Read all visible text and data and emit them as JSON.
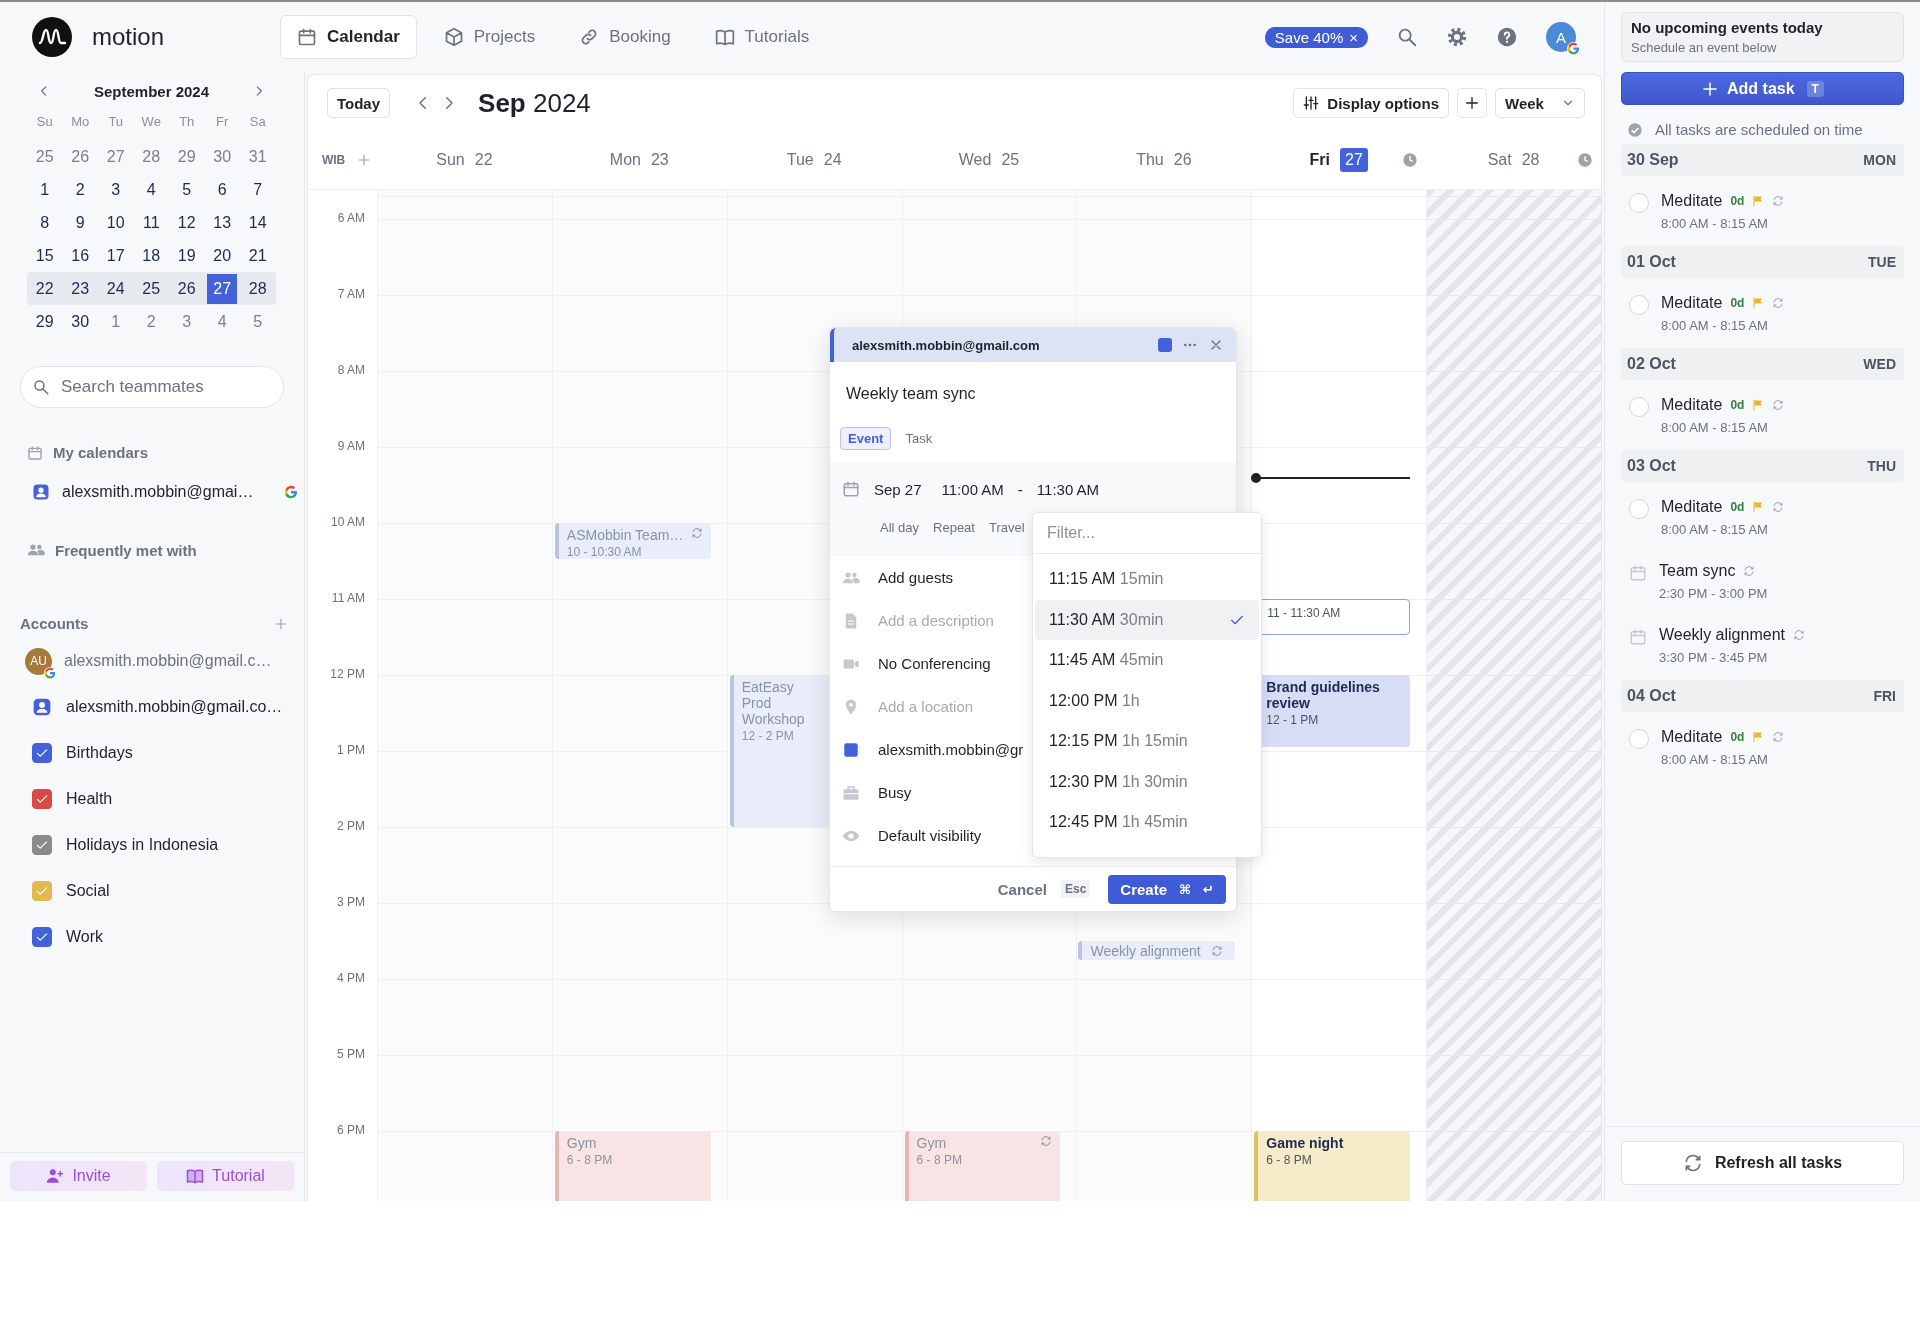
{
  "app": {
    "name": "motion"
  },
  "nav": {
    "tabs": [
      {
        "label": "Calendar",
        "selected": true
      },
      {
        "label": "Projects",
        "selected": false
      },
      {
        "label": "Booking",
        "selected": false
      },
      {
        "label": "Tutorials",
        "selected": false
      }
    ]
  },
  "promo": {
    "label": "Save 40%",
    "close": "×"
  },
  "avatar": {
    "initial": "A"
  },
  "mini_calendar": {
    "title": "September 2024",
    "weekdays": [
      "Su",
      "Mo",
      "Tu",
      "We",
      "Th",
      "Fr",
      "Sa"
    ],
    "weeks": [
      {
        "highlighted": false,
        "days": [
          {
            "day": "25",
            "muted": true,
            "selected": false
          },
          {
            "day": "26",
            "muted": true,
            "selected": false
          },
          {
            "day": "27",
            "muted": true,
            "selected": false
          },
          {
            "day": "28",
            "muted": true,
            "selected": false
          },
          {
            "day": "29",
            "muted": true,
            "selected": false
          },
          {
            "day": "30",
            "muted": true,
            "selected": false
          },
          {
            "day": "31",
            "muted": true,
            "selected": false
          }
        ]
      },
      {
        "highlighted": false,
        "days": [
          {
            "day": "1",
            "muted": false,
            "selected": false
          },
          {
            "day": "2",
            "muted": false,
            "selected": false
          },
          {
            "day": "3",
            "muted": false,
            "selected": false
          },
          {
            "day": "4",
            "muted": false,
            "selected": false
          },
          {
            "day": "5",
            "muted": false,
            "selected": false
          },
          {
            "day": "6",
            "muted": false,
            "selected": false
          },
          {
            "day": "7",
            "muted": false,
            "selected": false
          }
        ]
      },
      {
        "highlighted": false,
        "days": [
          {
            "day": "8",
            "muted": false,
            "selected": false
          },
          {
            "day": "9",
            "muted": false,
            "selected": false
          },
          {
            "day": "10",
            "muted": false,
            "selected": false
          },
          {
            "day": "11",
            "muted": false,
            "selected": false
          },
          {
            "day": "12",
            "muted": false,
            "selected": false
          },
          {
            "day": "13",
            "muted": false,
            "selected": false
          },
          {
            "day": "14",
            "muted": false,
            "selected": false
          }
        ]
      },
      {
        "highlighted": false,
        "days": [
          {
            "day": "15",
            "muted": false,
            "selected": false
          },
          {
            "day": "16",
            "muted": false,
            "selected": false
          },
          {
            "day": "17",
            "muted": false,
            "selected": false
          },
          {
            "day": "18",
            "muted": false,
            "selected": false
          },
          {
            "day": "19",
            "muted": false,
            "selected": false
          },
          {
            "day": "20",
            "muted": false,
            "selected": false
          },
          {
            "day": "21",
            "muted": false,
            "selected": false
          }
        ]
      },
      {
        "highlighted": true,
        "days": [
          {
            "day": "22",
            "muted": false,
            "selected": false
          },
          {
            "day": "23",
            "muted": false,
            "selected": false
          },
          {
            "day": "24",
            "muted": false,
            "selected": false
          },
          {
            "day": "25",
            "muted": false,
            "selected": false
          },
          {
            "day": "26",
            "muted": false,
            "selected": false
          },
          {
            "day": "27",
            "muted": false,
            "selected": true
          },
          {
            "day": "28",
            "muted": false,
            "selected": false
          }
        ]
      },
      {
        "highlighted": false,
        "days": [
          {
            "day": "29",
            "muted": false,
            "selected": false
          },
          {
            "day": "30",
            "muted": false,
            "selected": false
          },
          {
            "day": "1",
            "muted": true,
            "selected": false
          },
          {
            "day": "2",
            "muted": true,
            "selected": false
          },
          {
            "day": "3",
            "muted": true,
            "selected": false
          },
          {
            "day": "4",
            "muted": true,
            "selected": false
          },
          {
            "day": "5",
            "muted": true,
            "selected": false
          }
        ]
      }
    ]
  },
  "team_search": {
    "placeholder": "Search teammates"
  },
  "my_calendars": {
    "title": "My calendars",
    "items": [
      {
        "label": "alexsmith.mobbin@gmai…"
      }
    ]
  },
  "frequently_met": {
    "title": "Frequently met with"
  },
  "accounts": {
    "title": "Accounts",
    "items": [
      {
        "kind": "account",
        "label": "alexsmith.mobbin@gmail.c…",
        "initials": "AU"
      },
      {
        "kind": "calendar",
        "label": "alexsmith.mobbin@gmail.co…"
      },
      {
        "kind": "checkbox",
        "label": "Birthdays",
        "checked": true,
        "color": "#4361d8"
      },
      {
        "kind": "checkbox",
        "label": "Health",
        "checked": true,
        "color": "#d84a45"
      },
      {
        "kind": "checkbox",
        "label": "Holidays in Indonesia",
        "checked": true,
        "color": "#8a8a8a"
      },
      {
        "kind": "checkbox",
        "label": "Social",
        "checked": true,
        "color": "#e3b94f"
      },
      {
        "kind": "checkbox",
        "label": "Work",
        "checked": true,
        "color": "#4361d8"
      }
    ]
  },
  "sidebar_buttons": [
    {
      "label": "Invite"
    },
    {
      "label": "Tutorial"
    }
  ],
  "toolbar": {
    "today": "Today",
    "month": "Sep",
    "year": "2024",
    "display_options": "Display options",
    "view": "Week"
  },
  "timezone": "WIB",
  "hours": [
    "6 AM",
    "7 AM",
    "8 AM",
    "9 AM",
    "10 AM",
    "11 AM",
    "12 PM",
    "1 PM",
    "2 PM",
    "3 PM",
    "4 PM",
    "5 PM",
    "6 PM"
  ],
  "days": [
    {
      "name": "Sun",
      "date": "22",
      "selected": false,
      "unavailable": false
    },
    {
      "name": "Mon",
      "date": "23",
      "selected": false,
      "unavailable": false,
      "events": [
        {
          "kind": "block",
          "title": "ASMobbin Team…",
          "time": "10 - 10:30 AM",
          "color": "#e9ecf9",
          "repeat": true
        },
        {
          "kind": "block",
          "title": "Gym",
          "time": "6 - 8 PM",
          "color": "#f8e4e5",
          "repeat": false
        }
      ]
    },
    {
      "name": "Tue",
      "date": "24",
      "selected": false,
      "unavailable": false,
      "events": [
        {
          "kind": "block",
          "title": "EatEasy Prod Workshop",
          "time": "12 - 2 PM",
          "color": "#e9ecf9",
          "repeat": false
        }
      ]
    },
    {
      "name": "Wed",
      "date": "25",
      "selected": false,
      "unavailable": false,
      "events": [
        {
          "kind": "block",
          "title": "Gym",
          "time": "6 - 8 PM",
          "color": "#f8e4e5",
          "repeat": true
        }
      ]
    },
    {
      "name": "Thu",
      "date": "26",
      "selected": false,
      "unavailable": false,
      "events": [
        {
          "kind": "chip",
          "title": "Weekly alignment",
          "color": "#e9ecf9",
          "repeat": true
        }
      ]
    },
    {
      "name": "Fri",
      "date": "27",
      "selected": true,
      "unavailable": false,
      "events": [
        {
          "kind": "draft",
          "time": "11 - 11:30 AM",
          "color": "#8fa0e6"
        },
        {
          "kind": "block",
          "title": "Brand guidelines review",
          "time": "12 - 1 PM",
          "color": "#d8ddf6",
          "repeat": false
        },
        {
          "kind": "block",
          "title": "Game night",
          "time": "6 - 8 PM",
          "color": "#f6ebc8",
          "repeat": false
        }
      ]
    },
    {
      "name": "Sat",
      "date": "28",
      "selected": false,
      "unavailable": true
    }
  ],
  "popup": {
    "calendar": "alexsmith.mobbin@gmail.com",
    "color": "#4361d8",
    "title": "Weekly team sync",
    "tabs": [
      {
        "label": "Event",
        "selected": true
      },
      {
        "label": "Task",
        "selected": false
      }
    ],
    "date": "Sep 27",
    "start": "11:00 AM",
    "dash": "-",
    "end": "11:30 AM",
    "options": [
      "All day",
      "Repeat",
      "Travel"
    ],
    "rows": [
      {
        "value": "Add guests"
      },
      {
        "placeholder": "Add a description"
      },
      {
        "value": "No Conferencing"
      },
      {
        "placeholder": "Add a location"
      },
      {
        "value": "alexsmith.mobbin@gr",
        "color": "#4361d8"
      },
      {
        "value": "Busy"
      },
      {
        "value": "Default visibility"
      }
    ],
    "cancel": "Cancel",
    "cancel_key": "Esc",
    "create": "Create",
    "create_keys": [
      "⌘",
      "↵"
    ]
  },
  "time_dropdown": {
    "placeholder": "Filter...",
    "options": [
      {
        "time": "11:15 AM",
        "duration": "15min",
        "selected": false
      },
      {
        "time": "11:30 AM",
        "duration": "30min",
        "selected": true
      },
      {
        "time": "11:45 AM",
        "duration": "45min",
        "selected": false
      },
      {
        "time": "12:00 PM",
        "duration": "1h",
        "selected": false
      },
      {
        "time": "12:15 PM",
        "duration": "1h 15min",
        "selected": false
      },
      {
        "time": "12:30 PM",
        "duration": "1h 30min",
        "selected": false
      },
      {
        "time": "12:45 PM",
        "duration": "1h 45min",
        "selected": false
      }
    ]
  },
  "right_panel": {
    "upcoming": {
      "title": "No upcoming events today",
      "subtitle": "Schedule an event below"
    },
    "add_task": {
      "label": "Add task",
      "key": "T"
    },
    "status": "All tasks are scheduled on time",
    "groups": [
      {
        "date": "30 Sep",
        "weekday": "MON",
        "items": [
          {
            "kind": "task",
            "title": "Meditate",
            "due": "0d",
            "checked": false,
            "time": "8:00 AM - 8:15 AM"
          }
        ]
      },
      {
        "date": "01 Oct",
        "weekday": "TUE",
        "items": [
          {
            "kind": "task",
            "title": "Meditate",
            "due": "0d",
            "checked": false,
            "time": "8:00 AM - 8:15 AM"
          }
        ]
      },
      {
        "date": "02 Oct",
        "weekday": "WED",
        "items": [
          {
            "kind": "task",
            "title": "Meditate",
            "due": "0d",
            "checked": false,
            "time": "8:00 AM - 8:15 AM"
          }
        ]
      },
      {
        "date": "03 Oct",
        "weekday": "THU",
        "items": [
          {
            "kind": "task",
            "title": "Meditate",
            "due": "0d",
            "checked": false,
            "time": "8:00 AM - 8:15 AM"
          },
          {
            "kind": "event",
            "title": "Team sync",
            "time": "2:30 PM - 3:00 PM"
          },
          {
            "kind": "event",
            "title": "Weekly alignment",
            "time": "3:30 PM - 3:45 PM"
          }
        ]
      },
      {
        "date": "04 Oct",
        "weekday": "FRI",
        "items": [
          {
            "kind": "task",
            "title": "Meditate",
            "due": "0d",
            "checked": false,
            "time": "8:00 AM - 8:15 AM"
          }
        ]
      }
    ],
    "refresh": "Refresh all tasks"
  }
}
